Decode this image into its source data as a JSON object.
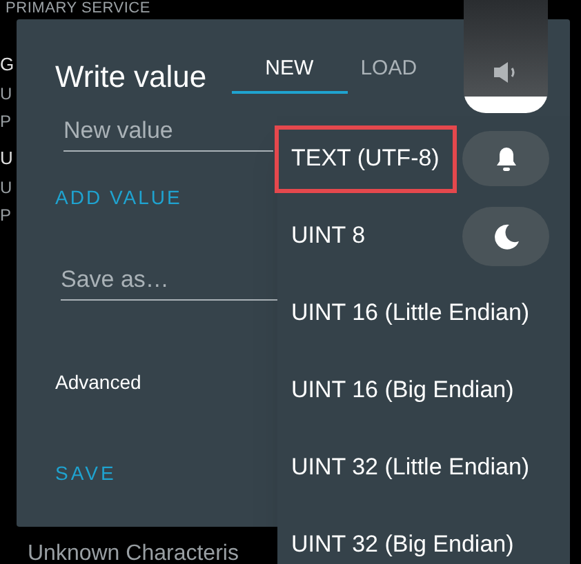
{
  "background": {
    "header": "PRIMARY SERVICE",
    "row_fragments": [
      {
        "text": "G",
        "kind": "title"
      },
      {
        "text": "U",
        "kind": "detail"
      },
      {
        "text": "P",
        "kind": "detail"
      },
      {
        "text": "U",
        "kind": "title"
      },
      {
        "text": "U",
        "kind": "detail"
      },
      {
        "text": "P",
        "kind": "detail"
      }
    ],
    "footer": "Unknown Characteris"
  },
  "dialog": {
    "title": "Write value",
    "tabs": [
      {
        "label": "NEW",
        "selected": true
      },
      {
        "label": "LOAD",
        "selected": false
      }
    ],
    "value_field": {
      "placeholder": "New value"
    },
    "add_value": "ADD VALUE",
    "save_as_field": {
      "placeholder": "Save as…"
    },
    "advanced": "Advanced",
    "save": "SAVE"
  },
  "format_menu": {
    "items": [
      {
        "label": "TEXT (UTF-8)",
        "selected": true
      },
      {
        "label": "UINT 8",
        "selected": false
      },
      {
        "label": "UINT 16 (Little Endian)",
        "selected": false
      },
      {
        "label": "UINT 16 (Big Endian)",
        "selected": false
      },
      {
        "label": "UINT 32 (Little Endian)",
        "selected": false
      },
      {
        "label": "UINT 32 (Big Endian)",
        "selected": false
      }
    ]
  },
  "volume": {
    "level": 0.15
  }
}
